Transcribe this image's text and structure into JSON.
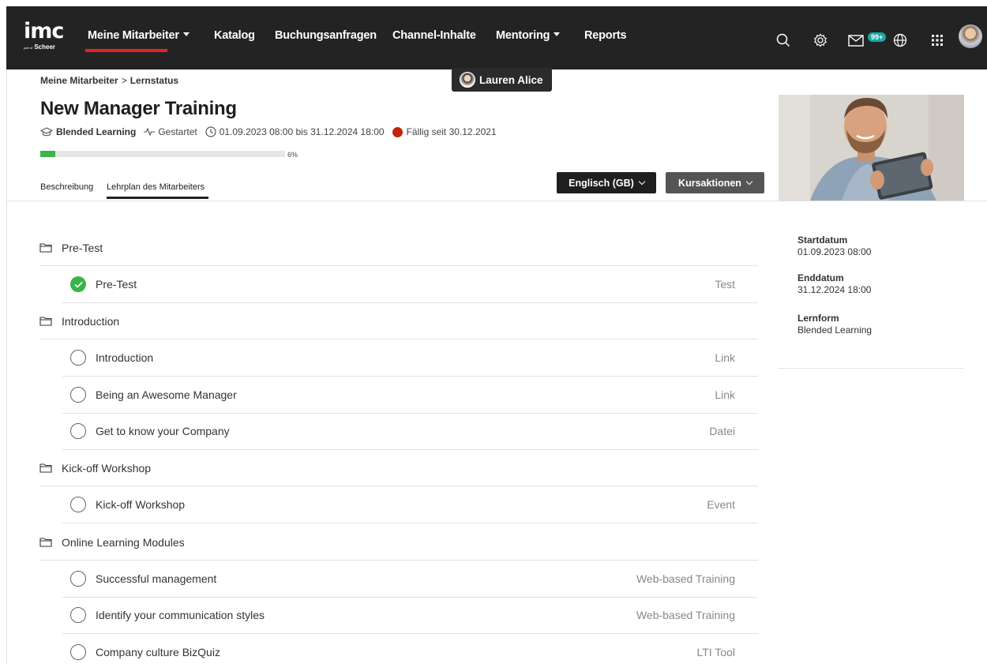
{
  "nav": {
    "logo": "imc",
    "logo_sub_small": "part of",
    "logo_sub": "Scheer",
    "items": [
      {
        "label": "Meine Mitarbeiter",
        "dropdown": true,
        "active": true
      },
      {
        "label": "Katalog"
      },
      {
        "label": "Buchungsanfragen"
      },
      {
        "label": "Channel-Inhalte"
      },
      {
        "label": "Mentoring",
        "dropdown": true
      },
      {
        "label": "Reports"
      }
    ],
    "icons": [
      "search-icon",
      "settings-icon",
      "messages-icon",
      "globe-icon",
      "apps-grid-icon",
      "user-avatar"
    ],
    "message_badge": "99+",
    "accent": "#e0261f"
  },
  "user_tooltip": {
    "name": "Lauren Alice"
  },
  "breadcrumb": {
    "parent": "Meine Mitarbeiter",
    "separator": ">",
    "current": "Lernstatus"
  },
  "course": {
    "title": "New Manager Training",
    "type": "Blended Learning",
    "status": "Gestartet",
    "period": "01.09.2023 08:00 bis 31.12.2024 18:00",
    "due": "Fällig seit 30.12.2021",
    "progress_percent": 6,
    "progress_label": "6%",
    "progress_color": "#3bb44a",
    "due_color": "#c0250e"
  },
  "tabs": [
    {
      "label": "Beschreibung",
      "active": false
    },
    {
      "label": "Lehrplan des Mitarbeiters",
      "active": true
    }
  ],
  "buttons": {
    "language": "Englisch (GB)",
    "actions": "Kursaktionen"
  },
  "curriculum": [
    {
      "section": "Pre-Test",
      "items": [
        {
          "title": "Pre-Test",
          "type": "Test",
          "completed": true
        }
      ]
    },
    {
      "section": "Introduction",
      "items": [
        {
          "title": "Introduction",
          "type": "Link",
          "completed": false
        },
        {
          "title": "Being an Awesome Manager",
          "type": "Link",
          "completed": false
        },
        {
          "title": "Get to know your Company",
          "type": "Datei",
          "completed": false
        }
      ]
    },
    {
      "section": "Kick-off Workshop",
      "items": [
        {
          "title": "Kick-off Workshop",
          "type": "Event",
          "completed": false
        }
      ]
    },
    {
      "section": "Online Learning Modules",
      "items": [
        {
          "title": "Successful management",
          "type": "Web-based Training",
          "completed": false
        },
        {
          "title": "Identify your communication styles",
          "type": "Web-based Training",
          "completed": false
        },
        {
          "title": "Company culture BizQuiz",
          "type": "LTI Tool",
          "completed": false
        }
      ]
    }
  ],
  "info": {
    "start_label": "Startdatum",
    "start_value": "01.09.2023 08:00",
    "end_label": "Enddatum",
    "end_value": "31.12.2024 18:00",
    "form_label": "Lernform",
    "form_value": "Blended Learning"
  }
}
